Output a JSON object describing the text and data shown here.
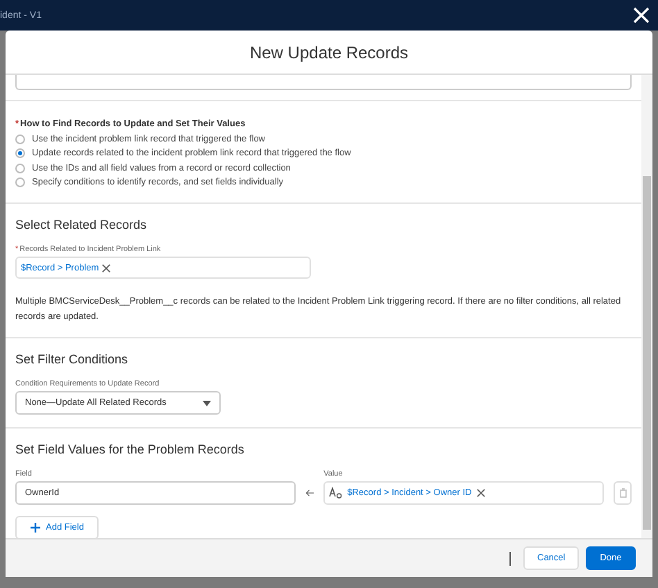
{
  "window": {
    "title": "ident - V1"
  },
  "modal": {
    "title": "New Update Records",
    "find_records": {
      "required_mark": "*",
      "label": "How to Find Records to Update and Set Their Values",
      "options": [
        {
          "label": "Use the incident problem link record that triggered the flow",
          "selected": false
        },
        {
          "label": "Update records related to the incident problem link record that triggered the flow",
          "selected": true
        },
        {
          "label": "Use the IDs and all field values from a record or record collection",
          "selected": false
        },
        {
          "label": "Specify conditions to identify records, and set fields individually",
          "selected": false
        }
      ]
    },
    "related": {
      "heading": "Select Related Records",
      "required_mark": "*",
      "label": "Records Related to Incident Problem Link",
      "pill": "$Record > Problem",
      "note": "Multiple BMCServiceDesk__Problem__c records can be related to the Incident Problem Link triggering record. If there are no filter conditions, all related records are updated."
    },
    "filter": {
      "heading": "Set Filter Conditions",
      "label": "Condition Requirements to Update Record",
      "value": "None—Update All Related Records"
    },
    "field_values": {
      "heading": "Set Field Values for the Problem Records",
      "field_label": "Field",
      "value_label": "Value",
      "rows": [
        {
          "field": "OwnerId",
          "value": "$Record > Incident > Owner ID"
        }
      ],
      "add_button": "Add Field"
    },
    "footer": {
      "buttons": [
        {
          "label": "Cancel",
          "kind": "neutral"
        },
        {
          "label": "Done",
          "kind": "brand"
        }
      ]
    }
  }
}
